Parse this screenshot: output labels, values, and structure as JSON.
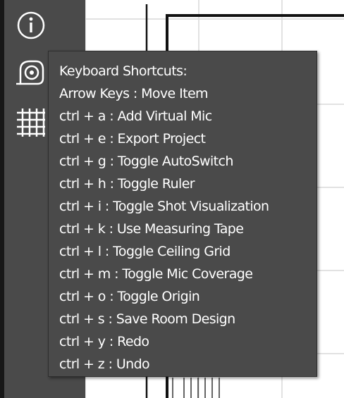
{
  "toolbar": {
    "tools": [
      {
        "icon": "info-icon"
      },
      {
        "icon": "measuring-tape-icon"
      },
      {
        "icon": "ceiling-grid-icon"
      }
    ]
  },
  "tooltip": {
    "title": "Keyboard Shortcuts:",
    "items": [
      "Arrow Keys : Move Item",
      "ctrl + a : Add Virtual Mic",
      "ctrl + e : Export Project",
      "ctrl + g : Toggle AutoSwitch",
      "ctrl + h : Toggle Ruler",
      "ctrl + i : Toggle Shot Visualization",
      "ctrl + k : Use Measuring Tape",
      "ctrl + l : Toggle Ceiling Grid",
      "ctrl + m : Toggle Mic Coverage",
      "ctrl + o : Toggle Origin",
      "ctrl + s : Save Room Design",
      "ctrl + y : Redo",
      "ctrl + z : Undo"
    ]
  },
  "colors": {
    "panel": "#4a4a4a",
    "toolbar_edge": "#171717",
    "text": "#ffffff",
    "grid": "#d9d9d9",
    "wall": "#111111"
  }
}
